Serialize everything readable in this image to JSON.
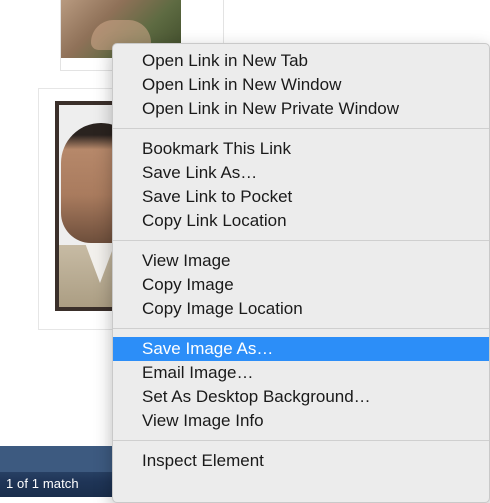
{
  "findbar": {
    "match_count": "1 of 1 match"
  },
  "context_menu": {
    "group1": [
      "Open Link in New Tab",
      "Open Link in New Window",
      "Open Link in New Private Window"
    ],
    "group2": [
      "Bookmark This Link",
      "Save Link As…",
      "Save Link to Pocket",
      "Copy Link Location"
    ],
    "group3": [
      "View Image",
      "Copy Image",
      "Copy Image Location"
    ],
    "group4": [
      "Save Image As…",
      "Email Image…",
      "Set As Desktop Background…",
      "View Image Info"
    ],
    "group5": [
      "Inspect Element"
    ],
    "highlighted_item": "Save Image As…",
    "highlight_color": "#2c8ef8"
  }
}
